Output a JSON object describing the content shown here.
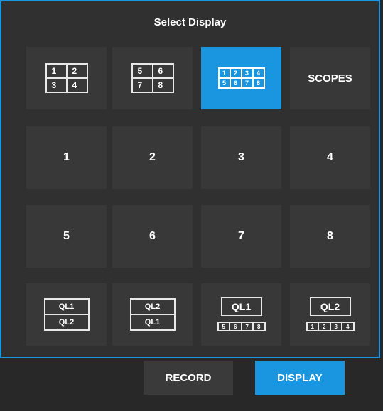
{
  "title": "Select Display",
  "colors": {
    "accent": "#1a95e0",
    "tile": "#383838",
    "panel": "#303030"
  },
  "layouts": {
    "quad_a": [
      "1",
      "2",
      "3",
      "4"
    ],
    "quad_b": [
      "5",
      "6",
      "7",
      "8"
    ],
    "octo": [
      "1",
      "2",
      "3",
      "4",
      "5",
      "6",
      "7",
      "8"
    ],
    "scopes": "SCOPES"
  },
  "single_displays": [
    "1",
    "2",
    "3",
    "4",
    "5",
    "6",
    "7",
    "8"
  ],
  "ql_layouts": {
    "ql1_over_ql2": [
      "QL1",
      "QL2"
    ],
    "ql2_over_ql1": [
      "QL2",
      "QL1"
    ],
    "ql1_plus": {
      "main": "QL1",
      "strip": [
        "5",
        "6",
        "7",
        "8"
      ]
    },
    "ql2_plus": {
      "main": "QL2",
      "strip": [
        "1",
        "2",
        "3",
        "4"
      ]
    }
  },
  "bottom_buttons": {
    "record": "RECORD",
    "display": "DISPLAY"
  }
}
